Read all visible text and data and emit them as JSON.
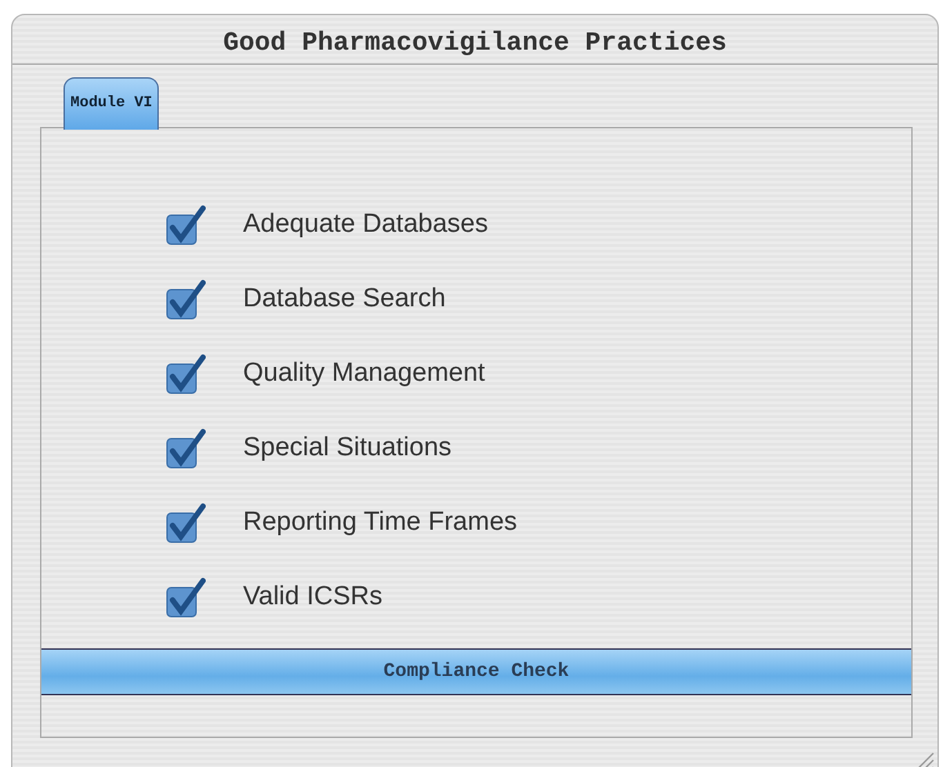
{
  "window": {
    "title": "Good Pharmacovigilance Practices"
  },
  "tabs": [
    {
      "label": "Module VI",
      "selected": true
    }
  ],
  "checklist": [
    {
      "label": "Adequate Databases",
      "checked": true
    },
    {
      "label": "Database Search",
      "checked": true
    },
    {
      "label": "Quality Management",
      "checked": true
    },
    {
      "label": "Special Situations",
      "checked": true
    },
    {
      "label": "Reporting Time Frames",
      "checked": true
    },
    {
      "label": "Valid ICSRs",
      "checked": true
    }
  ],
  "action": {
    "label": "Compliance Check"
  }
}
